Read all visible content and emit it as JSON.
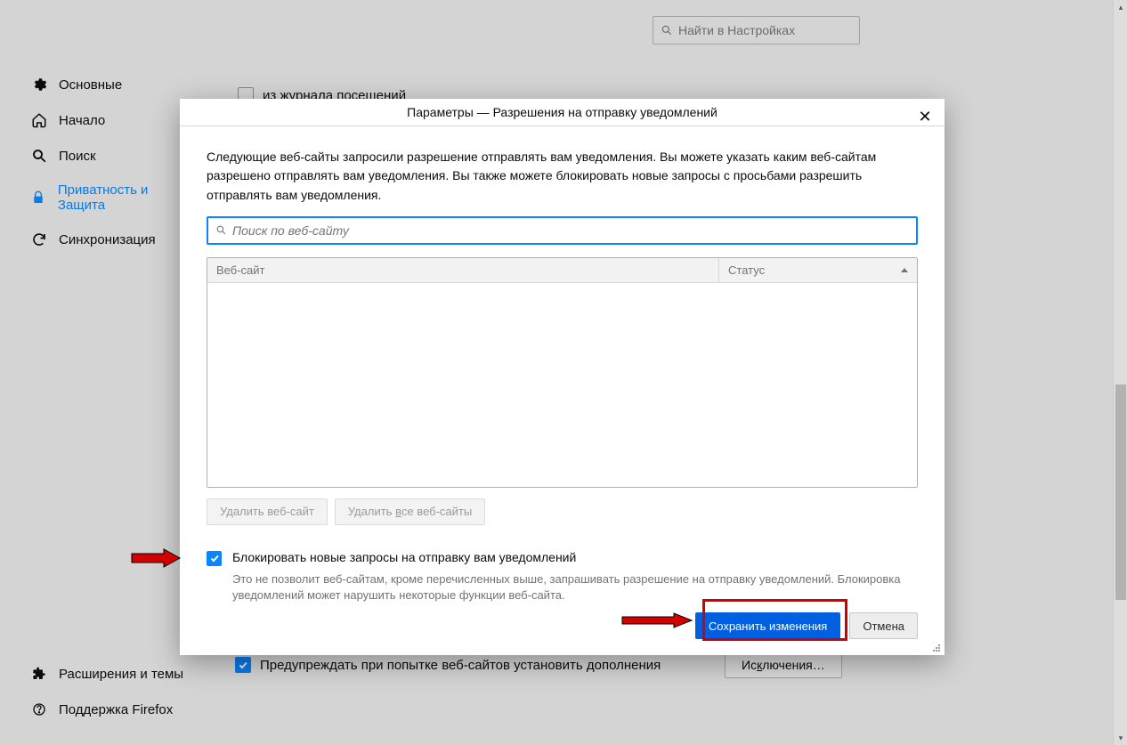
{
  "searchTop": {
    "placeholder": "Найти в Настройках"
  },
  "sidebar": {
    "items": [
      {
        "label": "Основные"
      },
      {
        "label": "Начало"
      },
      {
        "label": "Поиск"
      },
      {
        "label": "Приватность и Защита"
      },
      {
        "label": "Синхронизация"
      }
    ],
    "footer": [
      {
        "label": "Расширения и темы"
      },
      {
        "label": "Поддержка Firefox"
      }
    ]
  },
  "bgOption": {
    "pre": "из ",
    "underlined": "ж",
    "post": "урнала посещений"
  },
  "dialog": {
    "title": "Параметры — Разрешения на отправку уведомлений",
    "description": "Следующие веб-сайты запросили разрешение отправлять вам уведомления. Вы можете указать каким веб-сайтам разрешено отправлять вам уведомления. Вы также можете блокировать новые запросы с просьбами разрешить отправлять вам уведомления.",
    "searchPlaceholder": "Поиск по веб-сайту",
    "columns": {
      "site": "Веб-сайт",
      "status": "Статус"
    },
    "removeSite": "Удалить веб-сайт",
    "removeAll": "Удалить все веб-сайты",
    "removeAllUnderline": "в",
    "blockLabel": "Блокировать новые запросы на отправку вам уведомлений",
    "blockHint": "Это не позволит веб-сайтам, кроме перечисленных выше, запрашивать разрешение на отправку уведомлений. Блокировка уведомлений может нарушить некоторые функции веб-сайта.",
    "save": "Сохранить изменения",
    "cancel": "Отмена"
  },
  "bottom": {
    "pre": "Пре",
    "underlined": "д",
    "post": "упреждать при попытке веб-сайтов установить дополнения",
    "exceptionsPre": "Ис",
    "exceptionsU": "к",
    "exceptionsPost": "лючения…"
  }
}
